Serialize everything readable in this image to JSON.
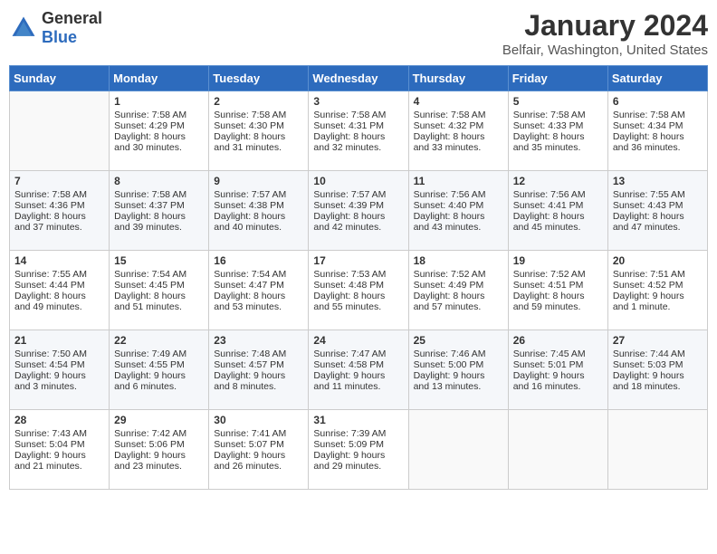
{
  "header": {
    "logo_general": "General",
    "logo_blue": "Blue",
    "title": "January 2024",
    "location": "Belfair, Washington, United States"
  },
  "calendar": {
    "days_of_week": [
      "Sunday",
      "Monday",
      "Tuesday",
      "Wednesday",
      "Thursday",
      "Friday",
      "Saturday"
    ],
    "weeks": [
      [
        {
          "day": "",
          "content": ""
        },
        {
          "day": "1",
          "content": "Sunrise: 7:58 AM\nSunset: 4:29 PM\nDaylight: 8 hours\nand 30 minutes."
        },
        {
          "day": "2",
          "content": "Sunrise: 7:58 AM\nSunset: 4:30 PM\nDaylight: 8 hours\nand 31 minutes."
        },
        {
          "day": "3",
          "content": "Sunrise: 7:58 AM\nSunset: 4:31 PM\nDaylight: 8 hours\nand 32 minutes."
        },
        {
          "day": "4",
          "content": "Sunrise: 7:58 AM\nSunset: 4:32 PM\nDaylight: 8 hours\nand 33 minutes."
        },
        {
          "day": "5",
          "content": "Sunrise: 7:58 AM\nSunset: 4:33 PM\nDaylight: 8 hours\nand 35 minutes."
        },
        {
          "day": "6",
          "content": "Sunrise: 7:58 AM\nSunset: 4:34 PM\nDaylight: 8 hours\nand 36 minutes."
        }
      ],
      [
        {
          "day": "7",
          "content": "Sunrise: 7:58 AM\nSunset: 4:36 PM\nDaylight: 8 hours\nand 37 minutes."
        },
        {
          "day": "8",
          "content": "Sunrise: 7:58 AM\nSunset: 4:37 PM\nDaylight: 8 hours\nand 39 minutes."
        },
        {
          "day": "9",
          "content": "Sunrise: 7:57 AM\nSunset: 4:38 PM\nDaylight: 8 hours\nand 40 minutes."
        },
        {
          "day": "10",
          "content": "Sunrise: 7:57 AM\nSunset: 4:39 PM\nDaylight: 8 hours\nand 42 minutes."
        },
        {
          "day": "11",
          "content": "Sunrise: 7:56 AM\nSunset: 4:40 PM\nDaylight: 8 hours\nand 43 minutes."
        },
        {
          "day": "12",
          "content": "Sunrise: 7:56 AM\nSunset: 4:41 PM\nDaylight: 8 hours\nand 45 minutes."
        },
        {
          "day": "13",
          "content": "Sunrise: 7:55 AM\nSunset: 4:43 PM\nDaylight: 8 hours\nand 47 minutes."
        }
      ],
      [
        {
          "day": "14",
          "content": "Sunrise: 7:55 AM\nSunset: 4:44 PM\nDaylight: 8 hours\nand 49 minutes."
        },
        {
          "day": "15",
          "content": "Sunrise: 7:54 AM\nSunset: 4:45 PM\nDaylight: 8 hours\nand 51 minutes."
        },
        {
          "day": "16",
          "content": "Sunrise: 7:54 AM\nSunset: 4:47 PM\nDaylight: 8 hours\nand 53 minutes."
        },
        {
          "day": "17",
          "content": "Sunrise: 7:53 AM\nSunset: 4:48 PM\nDaylight: 8 hours\nand 55 minutes."
        },
        {
          "day": "18",
          "content": "Sunrise: 7:52 AM\nSunset: 4:49 PM\nDaylight: 8 hours\nand 57 minutes."
        },
        {
          "day": "19",
          "content": "Sunrise: 7:52 AM\nSunset: 4:51 PM\nDaylight: 8 hours\nand 59 minutes."
        },
        {
          "day": "20",
          "content": "Sunrise: 7:51 AM\nSunset: 4:52 PM\nDaylight: 9 hours\nand 1 minute."
        }
      ],
      [
        {
          "day": "21",
          "content": "Sunrise: 7:50 AM\nSunset: 4:54 PM\nDaylight: 9 hours\nand 3 minutes."
        },
        {
          "day": "22",
          "content": "Sunrise: 7:49 AM\nSunset: 4:55 PM\nDaylight: 9 hours\nand 6 minutes."
        },
        {
          "day": "23",
          "content": "Sunrise: 7:48 AM\nSunset: 4:57 PM\nDaylight: 9 hours\nand 8 minutes."
        },
        {
          "day": "24",
          "content": "Sunrise: 7:47 AM\nSunset: 4:58 PM\nDaylight: 9 hours\nand 11 minutes."
        },
        {
          "day": "25",
          "content": "Sunrise: 7:46 AM\nSunset: 5:00 PM\nDaylight: 9 hours\nand 13 minutes."
        },
        {
          "day": "26",
          "content": "Sunrise: 7:45 AM\nSunset: 5:01 PM\nDaylight: 9 hours\nand 16 minutes."
        },
        {
          "day": "27",
          "content": "Sunrise: 7:44 AM\nSunset: 5:03 PM\nDaylight: 9 hours\nand 18 minutes."
        }
      ],
      [
        {
          "day": "28",
          "content": "Sunrise: 7:43 AM\nSunset: 5:04 PM\nDaylight: 9 hours\nand 21 minutes."
        },
        {
          "day": "29",
          "content": "Sunrise: 7:42 AM\nSunset: 5:06 PM\nDaylight: 9 hours\nand 23 minutes."
        },
        {
          "day": "30",
          "content": "Sunrise: 7:41 AM\nSunset: 5:07 PM\nDaylight: 9 hours\nand 26 minutes."
        },
        {
          "day": "31",
          "content": "Sunrise: 7:39 AM\nSunset: 5:09 PM\nDaylight: 9 hours\nand 29 minutes."
        },
        {
          "day": "",
          "content": ""
        },
        {
          "day": "",
          "content": ""
        },
        {
          "day": "",
          "content": ""
        }
      ]
    ]
  }
}
